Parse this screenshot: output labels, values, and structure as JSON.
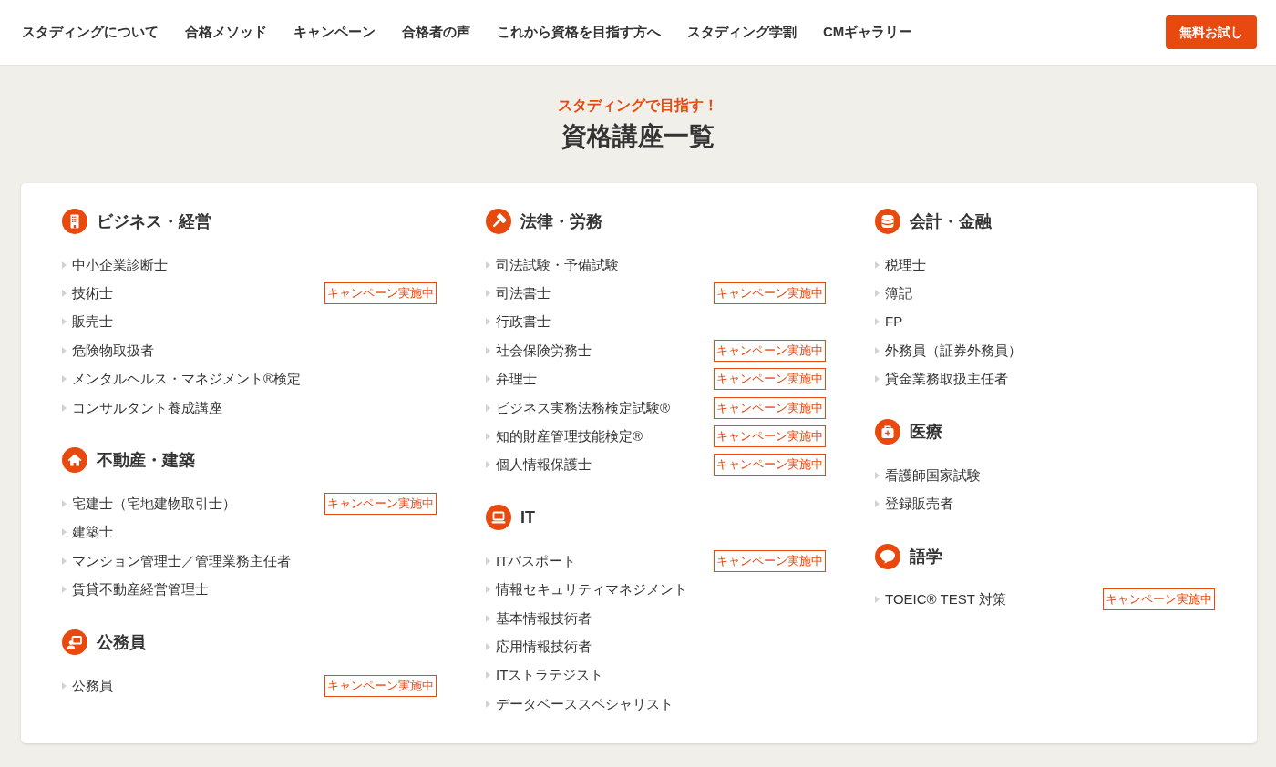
{
  "nav": {
    "links": [
      "スタディングについて",
      "合格メソッド",
      "キャンペーン",
      "合格者の声",
      "これから資格を目指す方へ",
      "スタディング学割",
      "CMギャラリー"
    ],
    "trial_button": "無料お試し"
  },
  "heading": {
    "eyebrow": "スタディングで目指す！",
    "title": "資格講座一覧"
  },
  "columns": [
    {
      "categories": [
        {
          "title": "ビジネス・経営",
          "courses": [
            {
              "name": "中小企業診断士"
            },
            {
              "name": "技術士",
              "badge": "キャンペーン実施中"
            },
            {
              "name": "販売士"
            },
            {
              "name": "危険物取扱者"
            },
            {
              "name": "メンタルヘルス・マネジメント®検定"
            },
            {
              "name": "コンサルタント養成講座"
            }
          ]
        },
        {
          "title": "不動産・建築",
          "courses": [
            {
              "name": "宅建士（宅地建物取引士）",
              "badge": "キャンペーン実施中"
            },
            {
              "name": "建築士"
            },
            {
              "name": "マンション管理士／管理業務主任者"
            },
            {
              "name": "賃貸不動産経営管理士"
            }
          ]
        },
        {
          "title": "公務員",
          "courses": [
            {
              "name": "公務員",
              "badge": "キャンペーン実施中"
            }
          ]
        }
      ]
    },
    {
      "categories": [
        {
          "title": "法律・労務",
          "courses": [
            {
              "name": "司法試験・予備試験"
            },
            {
              "name": "司法書士",
              "badge": "キャンペーン実施中"
            },
            {
              "name": "行政書士"
            },
            {
              "name": "社会保険労務士",
              "badge": "キャンペーン実施中"
            },
            {
              "name": "弁理士",
              "badge": "キャンペーン実施中"
            },
            {
              "name": "ビジネス実務法務検定試験®",
              "badge": "キャンペーン実施中"
            },
            {
              "name": "知的財産管理技能検定®",
              "badge": "キャンペーン実施中"
            },
            {
              "name": "個人情報保護士",
              "badge": "キャンペーン実施中"
            }
          ]
        },
        {
          "title": "IT",
          "courses": [
            {
              "name": "ITパスポート",
              "badge": "キャンペーン実施中"
            },
            {
              "name": "情報セキュリティマネジメント"
            },
            {
              "name": "基本情報技術者"
            },
            {
              "name": "応用情報技術者"
            },
            {
              "name": "ITストラテジスト"
            },
            {
              "name": "データベーススペシャリスト"
            }
          ]
        }
      ]
    },
    {
      "categories": [
        {
          "title": "会計・金融",
          "courses": [
            {
              "name": "税理士"
            },
            {
              "name": "簿記"
            },
            {
              "name": "FP"
            },
            {
              "name": "外務員（証券外務員）"
            },
            {
              "name": "貸金業務取扱主任者"
            }
          ]
        },
        {
          "title": "医療",
          "courses": [
            {
              "name": "看護師国家試験"
            },
            {
              "name": "登録販売者"
            }
          ]
        },
        {
          "title": "語学",
          "courses": [
            {
              "name": "TOEIC® TEST 対策",
              "badge": "キャンペーン実施中"
            }
          ]
        }
      ]
    }
  ]
}
